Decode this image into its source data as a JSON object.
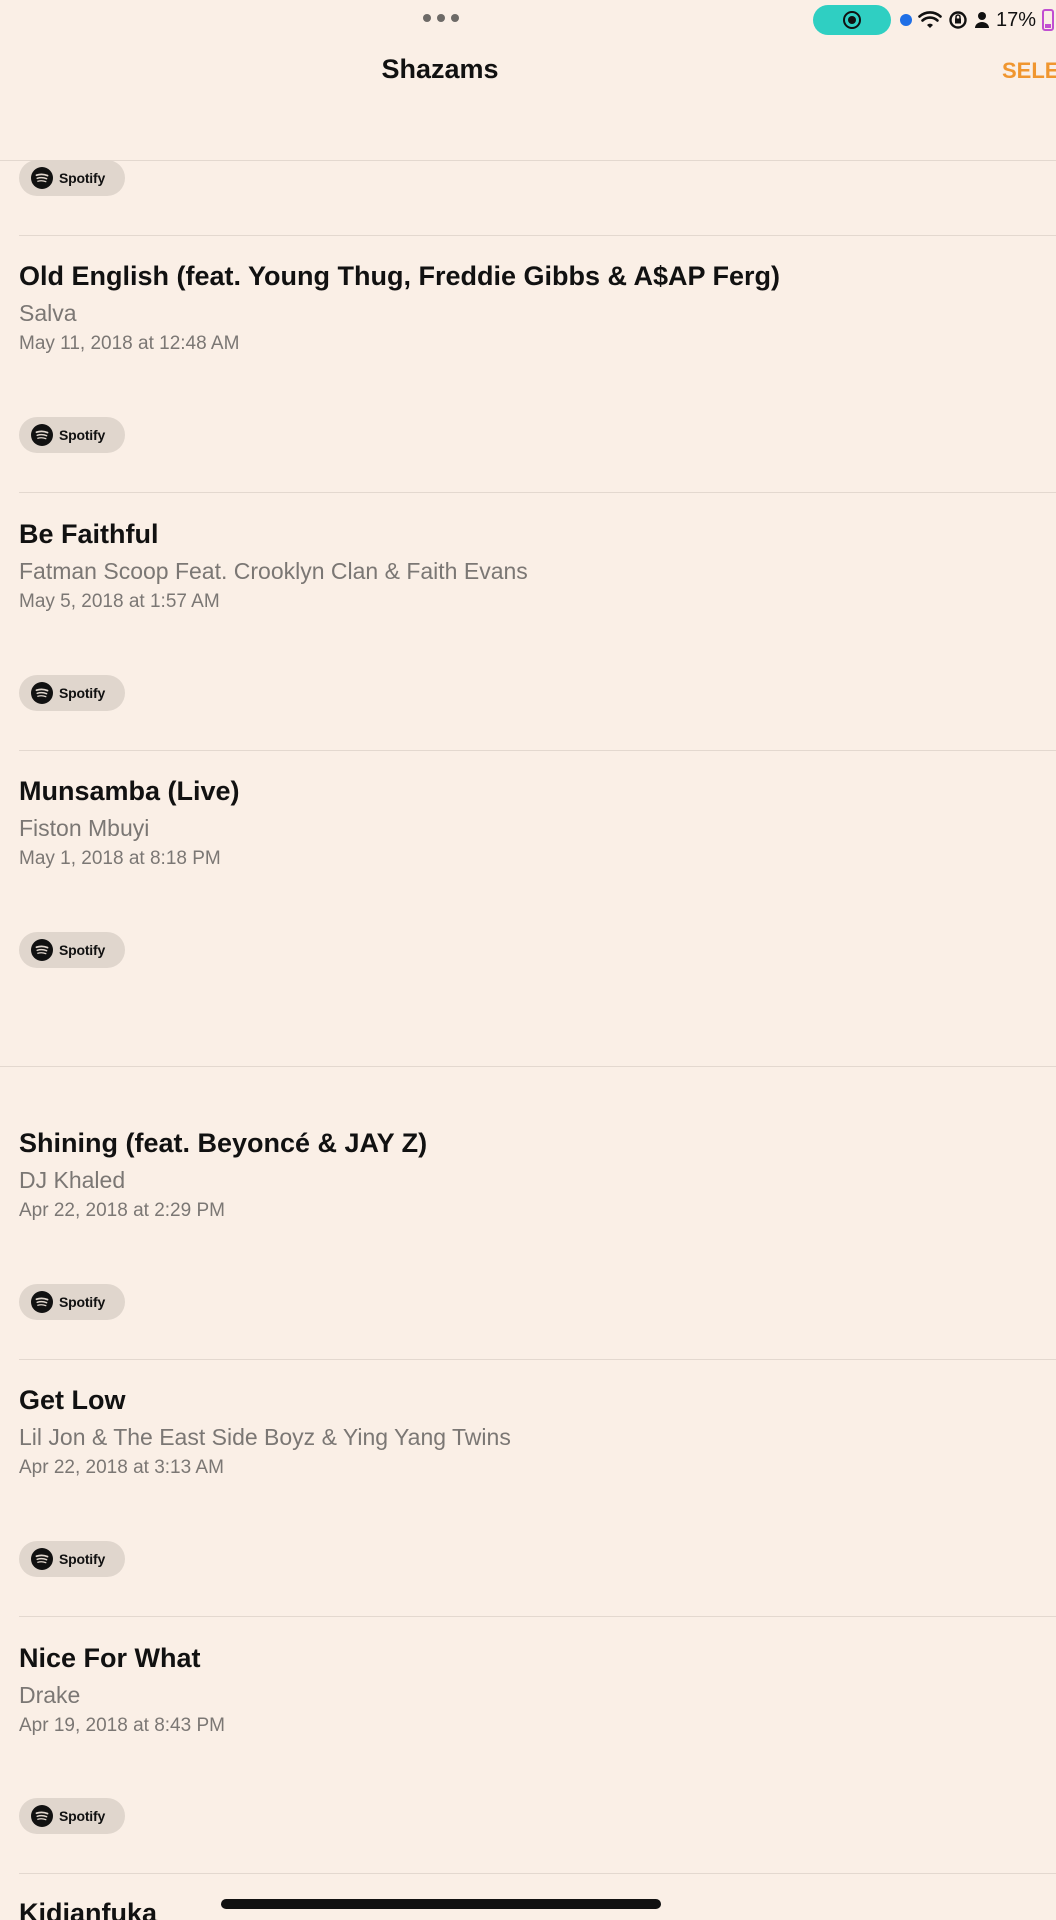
{
  "status_bar": {
    "battery_percent": "17%",
    "icons": [
      "screen-recording-icon",
      "location-dot-icon",
      "wifi-icon",
      "orientation-lock-icon",
      "person-icon",
      "battery-icon"
    ]
  },
  "nav": {
    "title": "Shazams",
    "select_label": "SELE"
  },
  "spotify_label": "Spotify",
  "songs": [
    {
      "title": "Old English (feat. Young Thug, Freddie Gibbs & A$AP Ferg)",
      "artist": "Salva",
      "date": "May 11, 2018 at 12:48 AM"
    },
    {
      "title": "Be Faithful",
      "artist": "Fatman Scoop Feat. Crooklyn Clan & Faith Evans",
      "date": "May 5, 2018 at 1:57 AM"
    },
    {
      "title": "Munsamba (Live)",
      "artist": "Fiston Mbuyi",
      "date": "May 1, 2018 at 8:18 PM"
    },
    {
      "title": "Shining (feat. Beyoncé & JAY Z)",
      "artist": "DJ Khaled",
      "date": "Apr 22, 2018 at 2:29 PM"
    },
    {
      "title": "Get Low",
      "artist": "Lil Jon & The East Side Boyz & Ying Yang Twins",
      "date": "Apr 22, 2018 at 3:13 AM"
    },
    {
      "title": "Nice For What",
      "artist": "Drake",
      "date": "Apr 19, 2018 at 8:43 PM"
    },
    {
      "title": "Kidjanfuka",
      "artist": "",
      "date": ""
    }
  ],
  "colors": {
    "background": "#faefe6",
    "accent": "#f0962f",
    "recording": "#2fcfc2",
    "secondary_text": "#7b7774"
  }
}
